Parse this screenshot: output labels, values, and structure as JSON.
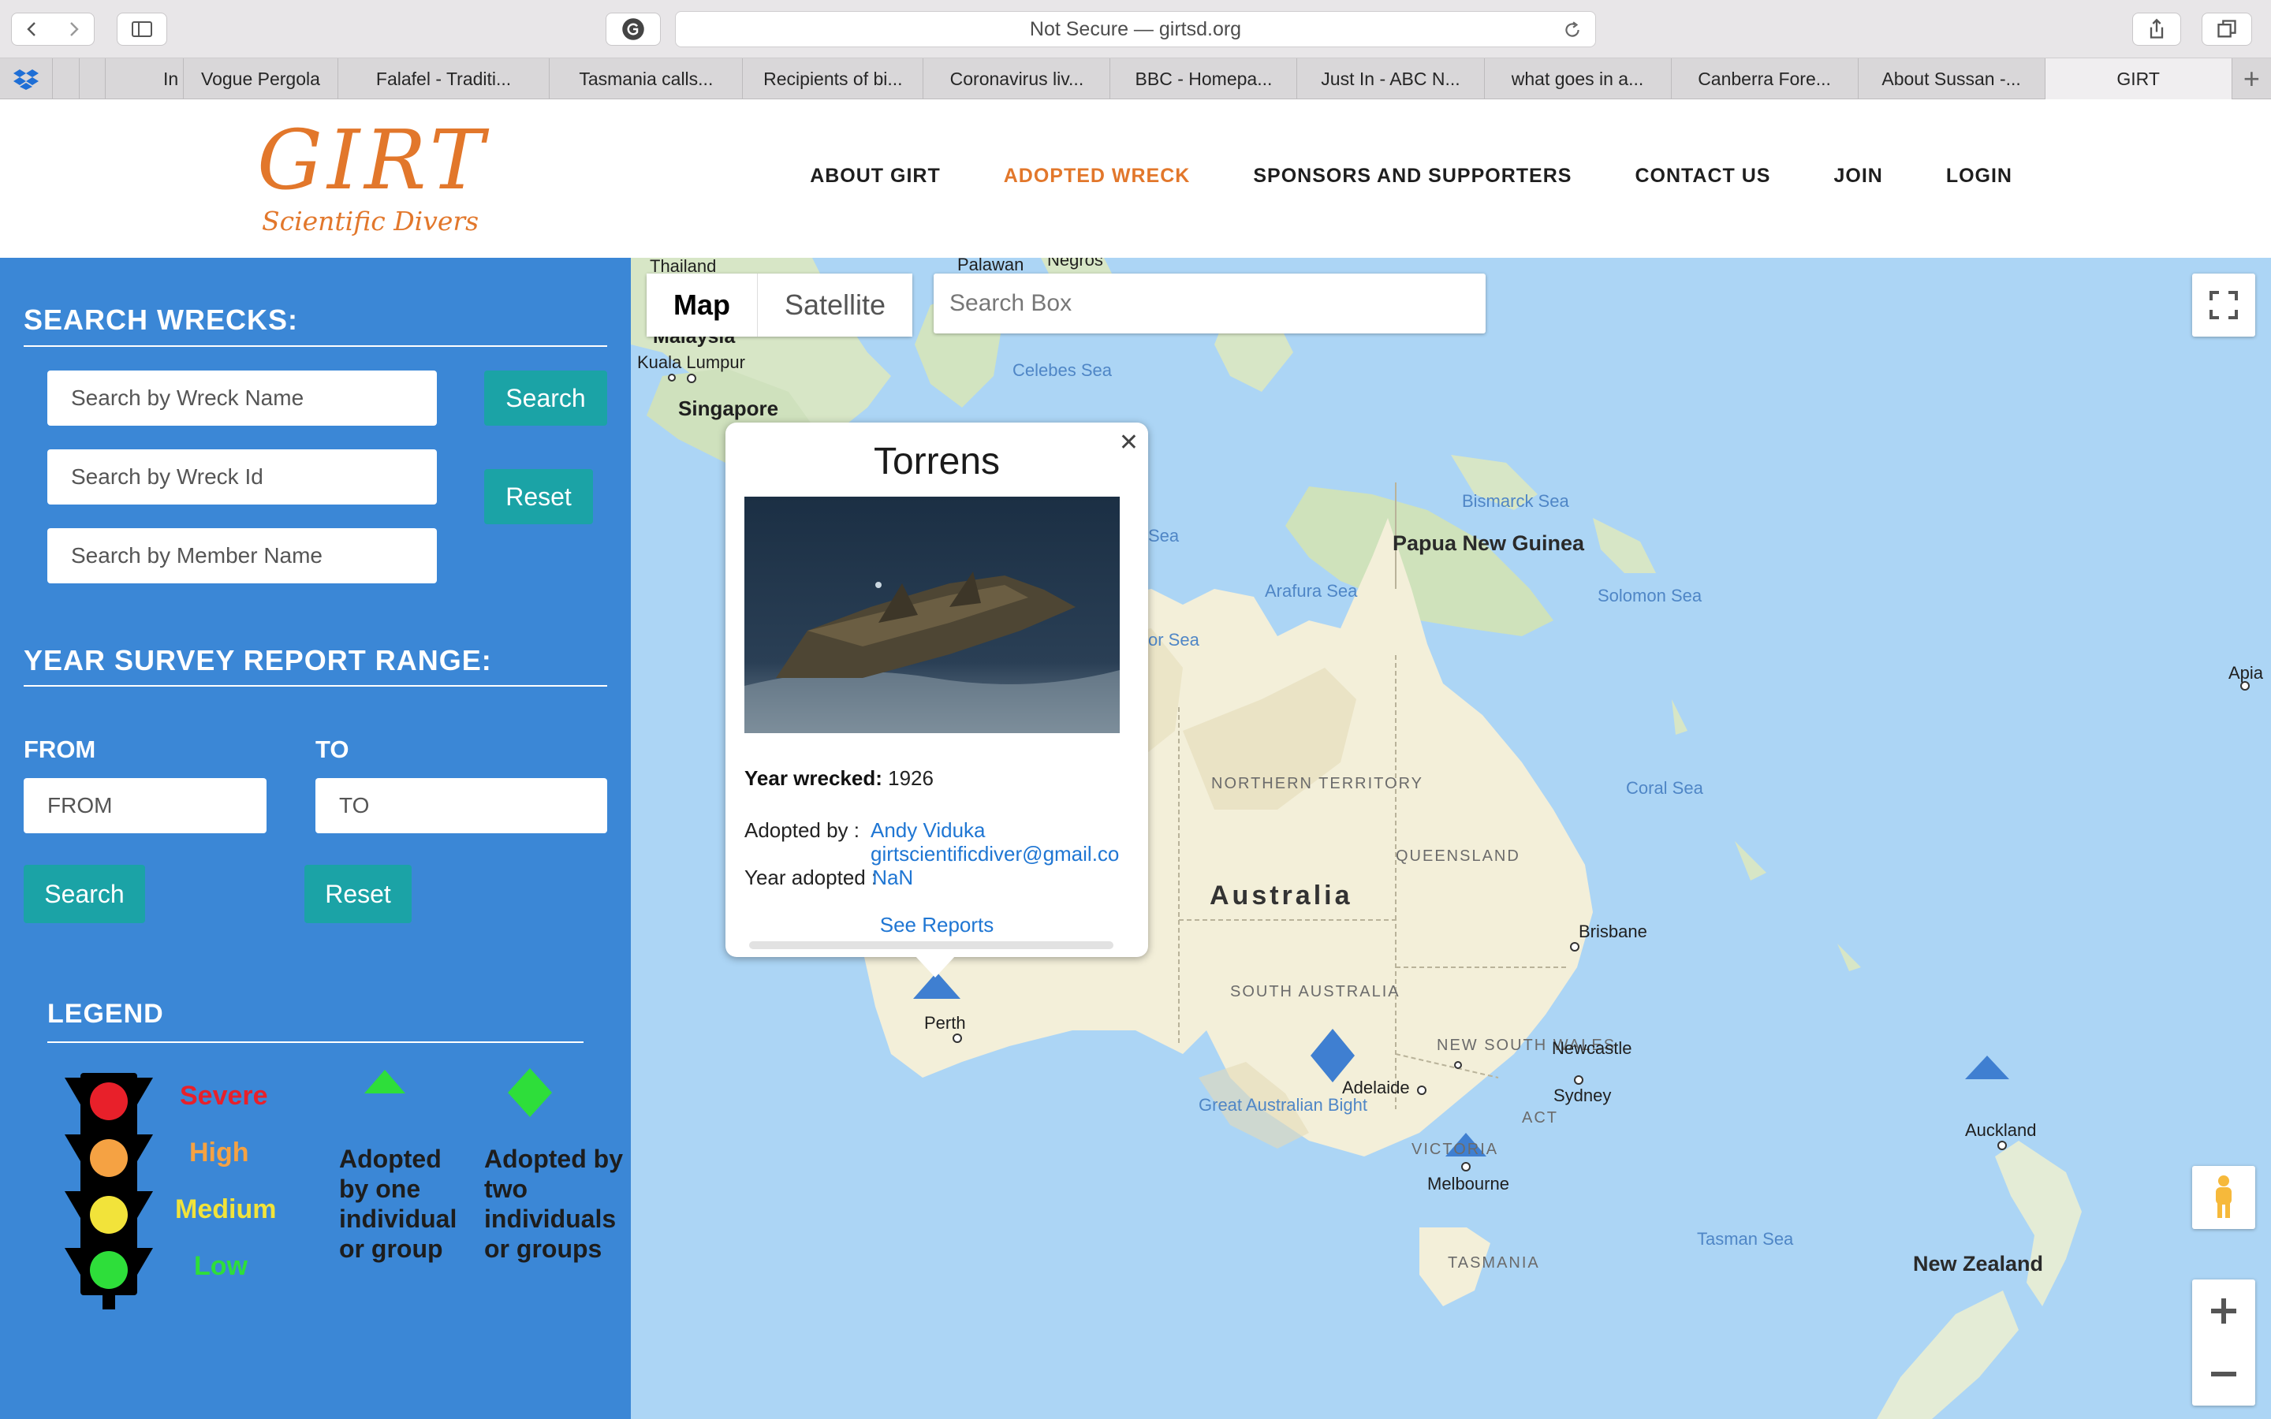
{
  "browser": {
    "address": "Not Secure — girtsd.org",
    "tabs": [
      "In",
      "Vogue Pergola",
      "Falafel - Traditi...",
      "Tasmania calls...",
      "Recipients of bi...",
      "Coronavirus liv...",
      "BBC - Homepa...",
      "Just In - ABC N...",
      "what goes in a...",
      "Canberra Fore...",
      "About Sussan -...",
      "GIRT"
    ]
  },
  "site": {
    "logo_main": "GIRT",
    "logo_sub": "Scientific Divers",
    "nav": [
      "ABOUT GIRT",
      "ADOPTED WRECK",
      "SPONSORS AND SUPPORTERS",
      "CONTACT US",
      "JOIN",
      "LOGIN"
    ],
    "active_nav": "ADOPTED WRECK"
  },
  "panel": {
    "search_title": "SEARCH WRECKS:",
    "wreck_name_placeholder": "Search by Wreck Name",
    "wreck_id_placeholder": "Search by Wreck Id",
    "member_placeholder": "Search by Member Name",
    "search_label": "Search",
    "reset_label": "Reset",
    "range_title": "YEAR SURVEY REPORT RANGE:",
    "from_label": "FROM",
    "to_label": "TO",
    "from_placeholder": "FROM",
    "to_placeholder": "TO",
    "legend_title": "LEGEND",
    "levels": [
      {
        "label": "Severe",
        "color": "#e8202a"
      },
      {
        "label": "High",
        "color": "#f5a243"
      },
      {
        "label": "Medium",
        "color": "#f2e33a"
      },
      {
        "label": "Low",
        "color": "#2ede3a"
      }
    ],
    "adopted_one": "Adopted by one individual or group",
    "adopted_two": "Adopted by two individuals or groups"
  },
  "map": {
    "type_map": "Map",
    "type_satellite": "Satellite",
    "search_placeholder": "Search Box",
    "labels": {
      "thailand": "Thailand",
      "palawan": "Palawan",
      "negros": "Negros",
      "malaysia": "Malaysia",
      "kuala": "Kuala Lumpur",
      "singapore": "Singapore",
      "celebes": "Celebes Sea",
      "bismarck": "Bismarck Sea",
      "png": "Papua New Guinea",
      "arafura": "Arafura Sea",
      "solomon": "Solomon Sea",
      "apia": "Apia",
      "timor": "or Sea",
      "banda": "Sea",
      "nt": "NORTHERN TERRITORY",
      "qld": "QUEENSLAND",
      "coral": "Coral Sea",
      "australia": "Australia",
      "brisbane": "Brisbane",
      "sa": "SOUTH AUSTRALIA",
      "nsw": "NEW SOUTH WALES",
      "newcastle": "Newcastle",
      "perth": "Perth",
      "adelaide": "Adelaide",
      "sydney": "Sydney",
      "act": "ACT",
      "bight": "Great Australian Bight",
      "vic": "VICTORIA",
      "melbourne": "Melbourne",
      "auckland": "Auckland",
      "tasmania": "TASMANIA",
      "tasman": "Tasman Sea",
      "nz": "New Zealand"
    }
  },
  "infowindow": {
    "title": "Torrens",
    "year_wrecked_label": "Year wrecked:",
    "year_wrecked": "1926",
    "adopted_by_label": "Adopted by :",
    "adopter_name": "Andy Viduka",
    "adopter_email": "girtscientificdiver@gmail.co",
    "year_adopted_label": "Year adopted :",
    "year_adopted": "NaN",
    "reports_label": "See Reports"
  }
}
